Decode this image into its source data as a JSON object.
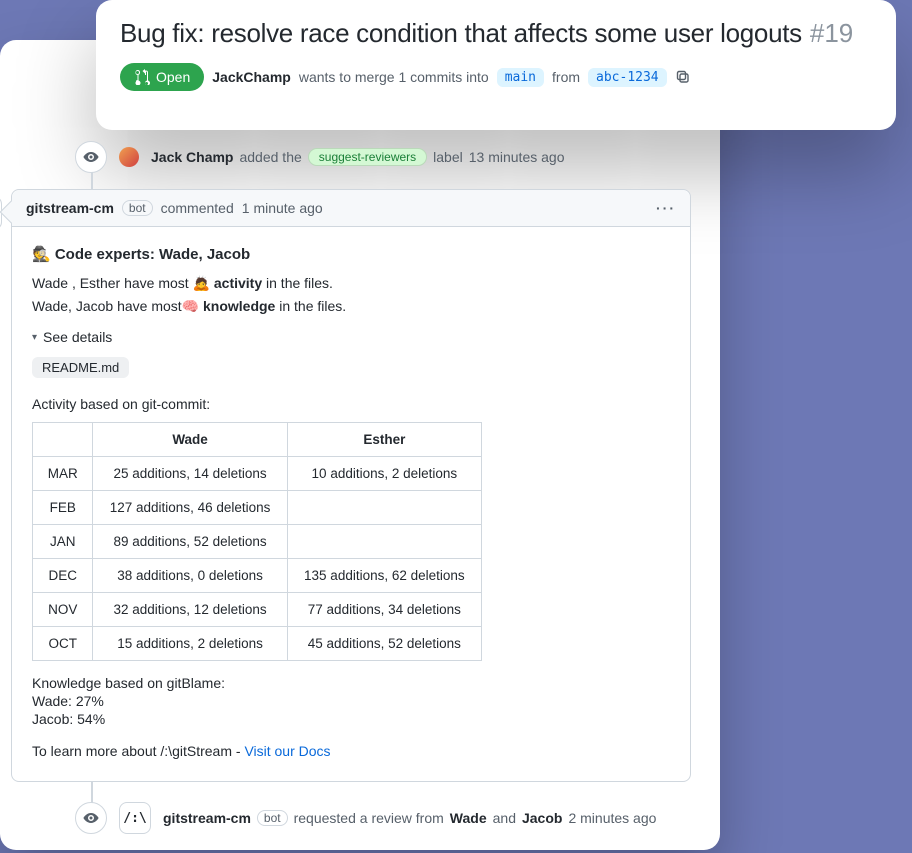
{
  "pr": {
    "title": "Bug fix: resolve race condition that affects some user logouts",
    "number": "#19",
    "status": "Open",
    "author": "JackChamp",
    "merge_text_1": "wants to merge 1 commits into",
    "base_branch": "main",
    "merge_text_2": "from",
    "head_branch": "abc-1234"
  },
  "event_label": {
    "actor": "Jack Champ",
    "action": "added the",
    "label": "suggest-reviewers",
    "suffix": "label",
    "time": "13 minutes ago"
  },
  "comment": {
    "actor": "gitstream-cm",
    "bot": "bot",
    "action": "commented",
    "time": "1 minute ago",
    "gitstream_logo": "/:\\",
    "heading": "🕵️ Code experts: Wade, Jacob",
    "line1_pre": "Wade , Esther have most 🙇",
    "line1_bold": "activity",
    "line1_post": "in the files.",
    "line2_pre": "Wade, Jacob have most🧠",
    "line2_bold": "knowledge",
    "line2_post": "in the files.",
    "details": "See details",
    "file": "README.md",
    "activity_heading": "Activity based on git-commit:",
    "table": {
      "col1": "Wade",
      "col2": "Esther",
      "rows": [
        {
          "month": "MAR",
          "c1": "25 additions, 14 deletions",
          "c2": "10 additions, 2 deletions"
        },
        {
          "month": "FEB",
          "c1": "127 additions, 46 deletions",
          "c2": ""
        },
        {
          "month": "JAN",
          "c1": "89 additions, 52 deletions",
          "c2": ""
        },
        {
          "month": "DEC",
          "c1": "38 additions, 0 deletions",
          "c2": "135 additions, 62 deletions"
        },
        {
          "month": "NOV",
          "c1": "32 additions, 12 deletions",
          "c2": "77 additions, 34 deletions"
        },
        {
          "month": "OCT",
          "c1": "15 additions, 2 deletions",
          "c2": "45 additions, 52 deletions"
        }
      ]
    },
    "knowledge_heading": "Knowledge based on gitBlame:",
    "knowledge_1": "Wade: 27%",
    "knowledge_2": "Jacob: 54%",
    "learn_more_pre": "To learn more about /:\\gitStream - ",
    "learn_more_link": "Visit our Docs"
  },
  "event_review": {
    "actor": "gitstream-cm",
    "bot": "bot",
    "action_pre": "requested a review from",
    "rev1": "Wade",
    "and": "and",
    "rev2": "Jacob",
    "time": "2 minutes ago"
  }
}
